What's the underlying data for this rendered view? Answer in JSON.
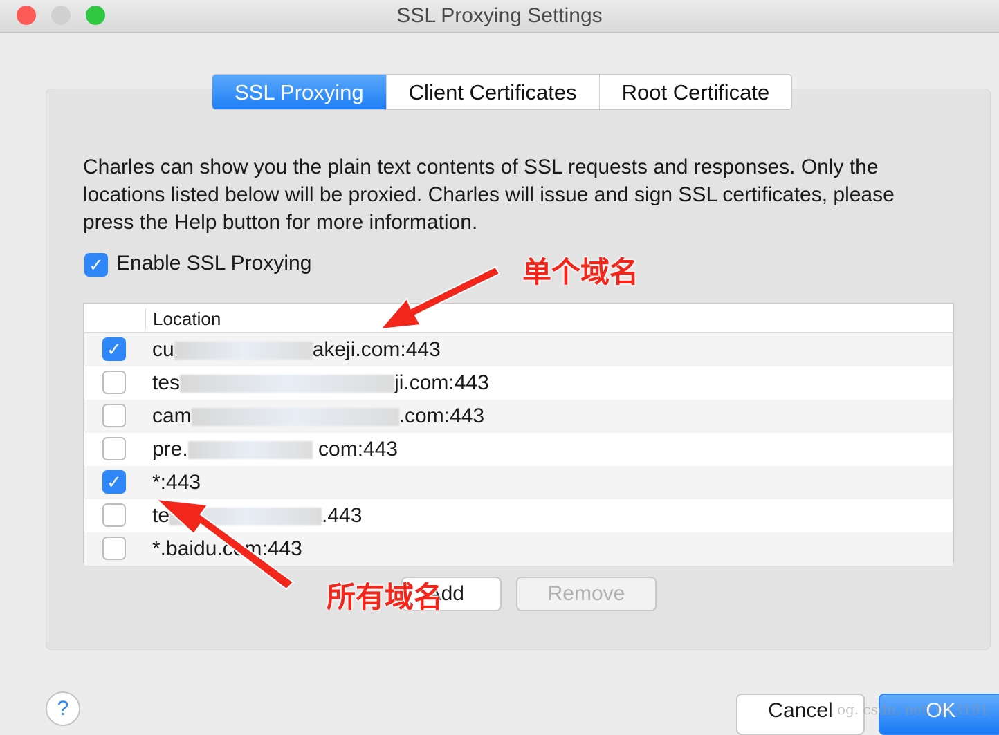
{
  "window": {
    "title": "SSL Proxying Settings"
  },
  "tabs": [
    {
      "label": "SSL Proxying",
      "active": true
    },
    {
      "label": "Client Certificates"
    },
    {
      "label": "Root Certificate"
    }
  ],
  "description": "Charles can show you the plain text contents of SSL requests and responses. Only the locations listed below will be proxied. Charles will issue and sign SSL certificates, please press the Help button for more information.",
  "enable": {
    "label": "Enable SSL Proxying",
    "checked": true
  },
  "table": {
    "header": "Location",
    "rows": [
      {
        "checked": true,
        "prefix": "cu",
        "suffix": "akeji.com:443"
      },
      {
        "checked": false,
        "prefix": "tes",
        "suffix": "ji.com:443"
      },
      {
        "checked": false,
        "prefix": "cam",
        "suffix": ".com:443"
      },
      {
        "checked": false,
        "prefix": "pre.",
        "suffix": " com:443"
      },
      {
        "checked": true,
        "prefix": "*:443",
        "suffix": ""
      },
      {
        "checked": false,
        "prefix": "te",
        "suffix": ".443"
      },
      {
        "checked": false,
        "prefix": "*.baidu.com:443",
        "suffix": ""
      }
    ]
  },
  "buttons": {
    "add": "Add",
    "remove": "Remove",
    "cancel": "Cancel",
    "ok": "OK",
    "help": "?"
  },
  "annotations": {
    "single": "单个域名",
    "all": "所有域名"
  },
  "watermark": "og. csdn. net/      013191",
  "colors": {
    "accent": "#2f87f7",
    "annotation": "#f2261b"
  }
}
